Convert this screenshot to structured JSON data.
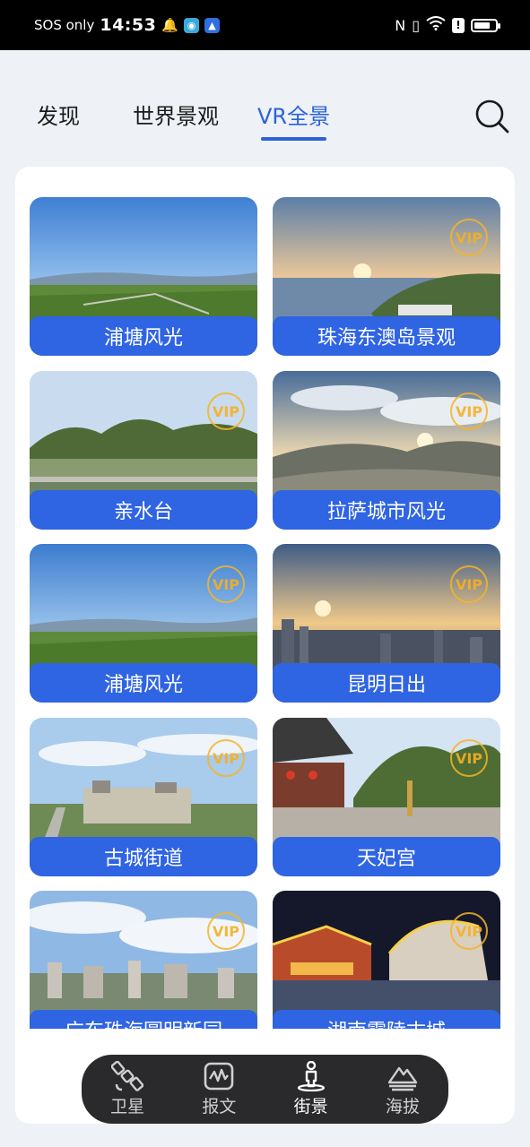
{
  "status_bar": {
    "carrier": "SOS only",
    "time": "14:53"
  },
  "tabs": [
    {
      "label": "发现"
    },
    {
      "label": "世界景观"
    },
    {
      "label": "VR全景",
      "active": true
    }
  ],
  "vip_badge": "VIP",
  "cards": [
    {
      "title": "浦塘风光",
      "vip": false
    },
    {
      "title": "珠海东澳岛景观",
      "vip": true
    },
    {
      "title": "亲水台",
      "vip": true
    },
    {
      "title": "拉萨城市风光",
      "vip": true
    },
    {
      "title": "浦塘风光",
      "vip": true
    },
    {
      "title": "昆明日出",
      "vip": true
    },
    {
      "title": "古城街道",
      "vip": true
    },
    {
      "title": "天妃宫",
      "vip": true
    },
    {
      "title": "广东珠海圆明新园",
      "vip": true
    },
    {
      "title": "湖南零陵古城",
      "vip": true
    }
  ],
  "bottom_nav": [
    {
      "label": "卫星",
      "icon": "satellite-icon"
    },
    {
      "label": "报文",
      "icon": "message-icon"
    },
    {
      "label": "街景",
      "icon": "street-view-icon",
      "active": true
    },
    {
      "label": "海拔",
      "icon": "altitude-icon"
    }
  ],
  "colors": {
    "accent": "#2a62d8",
    "card_label_bg": "#2f64e3",
    "vip_gold": "#f5b428",
    "nav_bg": "#2a2a2c"
  }
}
